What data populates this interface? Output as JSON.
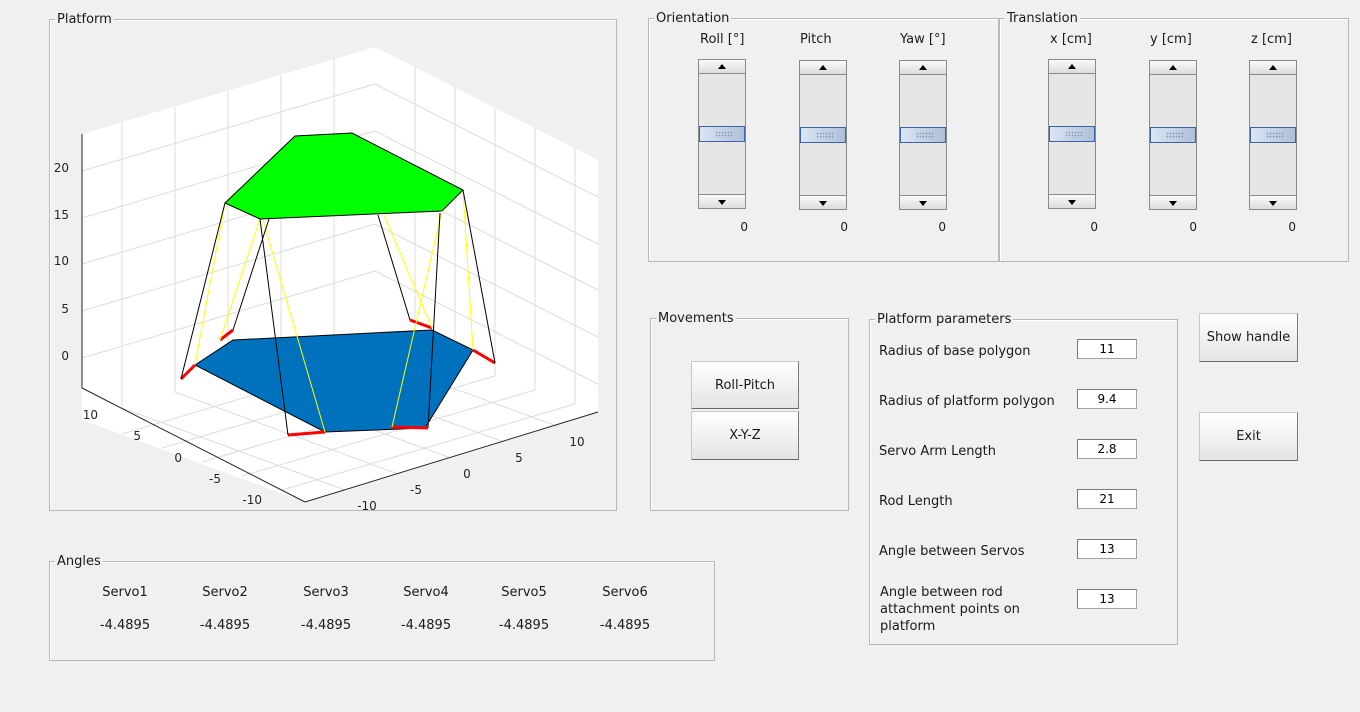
{
  "platform_panel": {
    "title": "Platform",
    "axes": {
      "z_ticks": [
        "20",
        "15",
        "10",
        "5",
        "0"
      ],
      "y_ticks": [
        "10",
        "5",
        "0",
        "-5",
        "-10"
      ],
      "x_ticks": [
        "-10",
        "-5",
        "0",
        "5",
        "10"
      ]
    },
    "colors": {
      "top_platform": "#00ff00",
      "base_polygon": "#0072bd",
      "servo_arm": "#ff0000",
      "rod_highlight": "#ffff00"
    }
  },
  "orientation": {
    "title": "Orientation",
    "sliders": [
      {
        "label": "Roll [°]",
        "value": "0",
        "position": 0.5
      },
      {
        "label": "Pitch",
        "value": "0",
        "position": 0.5
      },
      {
        "label": "Yaw [°]",
        "value": "0",
        "position": 0.5
      }
    ]
  },
  "translation": {
    "title": "Translation",
    "sliders": [
      {
        "label": "x [cm]",
        "value": "0",
        "position": 0.5
      },
      {
        "label": "y [cm]",
        "value": "0",
        "position": 0.5
      },
      {
        "label": "z [cm]",
        "value": "0",
        "position": 0.5
      }
    ]
  },
  "movements": {
    "title": "Movements",
    "buttons": [
      "Roll-Pitch",
      "X-Y-Z"
    ]
  },
  "parameters": {
    "title": "Platform parameters",
    "rows": [
      {
        "label": "Radius of base polygon",
        "value": "11"
      },
      {
        "label": "Radius of platform polygon",
        "value": "9.4"
      },
      {
        "label": "Servo Arm Length",
        "value": "2.8"
      },
      {
        "label": "Rod Length",
        "value": "21"
      },
      {
        "label": "Angle between Servos",
        "value": "13"
      },
      {
        "label": "Angle between rod attachment points on platform",
        "value": "13"
      }
    ]
  },
  "actions": {
    "show_handle": "Show handle",
    "exit": "Exit"
  },
  "angles": {
    "title": "Angles",
    "servos": [
      {
        "name": "Servo1",
        "value": "-4.4895"
      },
      {
        "name": "Servo2",
        "value": "-4.4895"
      },
      {
        "name": "Servo3",
        "value": "-4.4895"
      },
      {
        "name": "Servo4",
        "value": "-4.4895"
      },
      {
        "name": "Servo5",
        "value": "-4.4895"
      },
      {
        "name": "Servo6",
        "value": "-4.4895"
      }
    ]
  }
}
